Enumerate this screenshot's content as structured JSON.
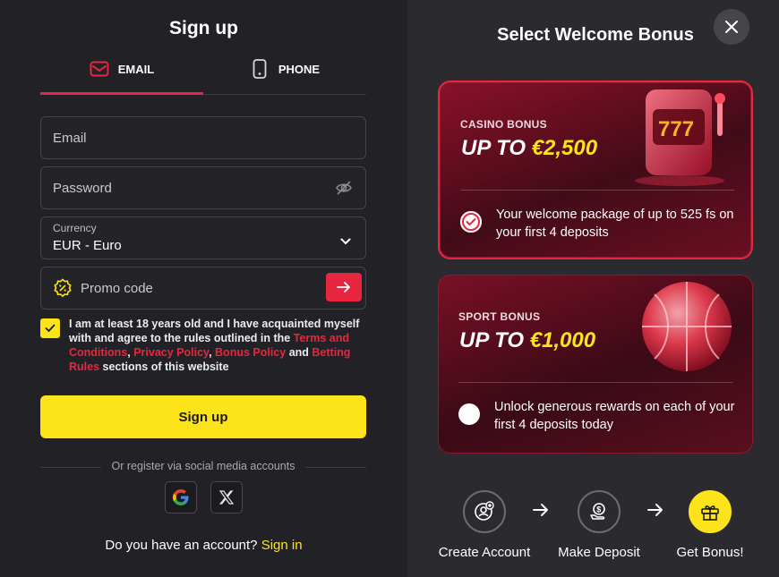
{
  "signup": {
    "title": "Sign up",
    "tabs": [
      {
        "label": "EMAIL",
        "icon": "envelope-icon"
      },
      {
        "label": "PHONE",
        "icon": "phone-icon"
      }
    ],
    "email_placeholder": "Email",
    "password_placeholder": "Password",
    "currency_label": "Currency",
    "currency_value": "EUR - Euro",
    "promo_placeholder": "Promo code",
    "agree": {
      "text_1": "I am at least 18 years old and I have acquainted myself with and agree to the rules outlined in the ",
      "terms": "Terms and Conditions",
      "comma1": ", ",
      "privacy": "Privacy Policy",
      "comma2": ", ",
      "bonus": "Bonus Policy",
      "and": " and ",
      "betting": "Betting Rules",
      "text_2": " sections of this website"
    },
    "submit_label": "Sign up",
    "social_divider": "Or register via social media accounts",
    "account_question": "Do you have an account? ",
    "sign_in_link": "Sign in"
  },
  "bonus": {
    "title": "Select Welcome Bonus",
    "cards": [
      {
        "kicker": "CASINO BONUS",
        "prefix": "UP TO ",
        "amount": "€2,500",
        "desc": "Your welcome package of up to 525 fs on your first 4 deposits",
        "selected": true
      },
      {
        "kicker": "SPORT BONUS",
        "prefix": "UP TO ",
        "amount": "€1,000",
        "desc": "Unlock generous rewards on each of your first 4 deposits today",
        "selected": false
      }
    ],
    "steps": [
      {
        "label": "Create Account",
        "icon": "user-add-icon"
      },
      {
        "label": "Make Deposit",
        "icon": "deposit-icon"
      },
      {
        "label": "Get Bonus!",
        "icon": "gift-icon"
      }
    ]
  },
  "colors": {
    "accent": "#e8263f",
    "brand_yellow": "#fde31a",
    "panel_bg": "#222226",
    "right_bg": "#2a2a2f"
  }
}
